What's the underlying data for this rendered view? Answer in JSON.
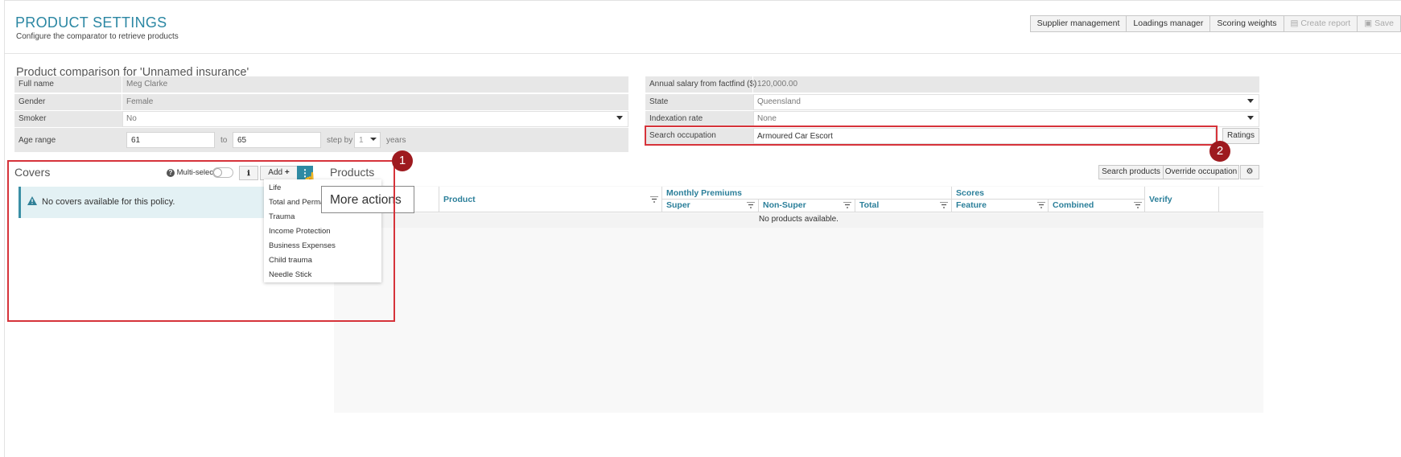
{
  "header": {
    "title": "PRODUCT SETTINGS",
    "subtitle": "Configure the comparator to retrieve products",
    "buttons": {
      "supplier": "Supplier management",
      "loadings": "Loadings manager",
      "scoring": "Scoring weights",
      "create_report": "Create report",
      "save": "Save"
    }
  },
  "comparison": {
    "title": "Product comparison for 'Unnamed insurance'",
    "full_name_label": "Full name",
    "full_name": "Meg Clarke",
    "gender_label": "Gender",
    "gender": "Female",
    "smoker_label": "Smoker",
    "smoker": "No",
    "age_range_label": "Age range",
    "age_from": "61",
    "age_to_label": "to",
    "age_to": "65",
    "step_label": "step by",
    "step": "1",
    "years_label": "years",
    "salary_label": "Annual salary from factfind ($)",
    "salary": "120,000.00",
    "state_label": "State",
    "state": "Queensland",
    "indexation_label": "Indexation rate",
    "indexation": "None",
    "occupation_label": "Search occupation",
    "occupation": "Armoured Car Escort",
    "ratings_button": "Ratings"
  },
  "covers": {
    "title": "Covers",
    "multi_select_label": "Multi-select",
    "add_label": "Add",
    "empty_message": "No covers available for this policy.",
    "menu_items": [
      "Life",
      "Total and Perma",
      "Trauma",
      "Income Protection",
      "Business Expenses",
      "Child trauma",
      "Needle Stick"
    ],
    "tooltip": "More actions"
  },
  "products": {
    "title": "Products",
    "search_button": "Search products",
    "override_button": "Override occupation",
    "columns": {
      "product": "Product",
      "monthly_premiums": "Monthly Premiums",
      "super": "Super",
      "non_super": "Non-Super",
      "total": "Total",
      "scores": "Scores",
      "feature": "Feature",
      "combined": "Combined",
      "verify": "Verify"
    },
    "empty_message": "No products available."
  },
  "annotations": {
    "badge_1": "1",
    "badge_2": "2"
  },
  "colors": {
    "accent": "#2b87a3",
    "highlight": "#d6333a",
    "badge": "#9e1a1f"
  }
}
